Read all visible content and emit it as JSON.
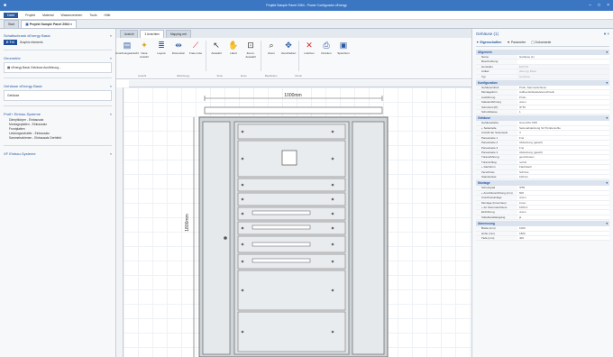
{
  "window": {
    "title": "Projekt Sample Panel 2064 - Power Configurator xEnergy",
    "minimize": "–",
    "maximize": "□",
    "close": "×"
  },
  "menu": {
    "file": "Datei",
    "items": [
      "Projekt",
      "Material",
      "Wasserzeichen",
      "Tools",
      "Hilfe"
    ]
  },
  "doc_tabs": [
    {
      "label": "Start"
    },
    {
      "label": "Projekt Sample Panel 2064",
      "close": "×"
    }
  ],
  "left": {
    "section1": {
      "title": "Schaltschrank xEnergy Basic",
      "collapse": "«"
    },
    "eaton_logo": "E·T·N",
    "eaton_link": "Graphic elements",
    "section2": {
      "title": "Geometrie",
      "collapse": "«"
    },
    "selection": "xEnergy Basic Gehäuse Ausführung...",
    "section3": {
      "title": "Gehäuse xEnergy Basic",
      "collapse": "«"
    },
    "housing_value": "Gehäuse",
    "section4": {
      "title": "Profi+ Einbau-Systeme",
      "collapse": "«"
    },
    "sub_items": [
      "Dämpfkörper - Einbausatz",
      "Montageplatten - Einbausatz",
      "Frontplatten",
      "Leistungsschalter - Einbausatz",
      "Sammelschienen - Einbausatz Drehfeld"
    ],
    "section5": {
      "title": "XF Einbau-Systeme",
      "collapse": "«"
    }
  },
  "canvas_tabs": [
    {
      "label": "Ansicht"
    },
    {
      "label": "3 Ansichten"
    },
    {
      "label": "Mapping.xml"
    }
  ],
  "ribbon": {
    "buttons": [
      {
        "label": "Anordnungsansicht"
      },
      {
        "label": "Neue Ansicht"
      },
      {
        "label": "Layout"
      },
      {
        "label": "Dimension"
      },
      {
        "label": "Freie Linie"
      },
      {
        "label": "Auswahl"
      },
      {
        "label": "Hand"
      },
      {
        "label": "Zoom-Auswahl"
      },
      {
        "label": "Zoom"
      },
      {
        "label": "Verschieben"
      },
      {
        "label": "Löschen"
      },
      {
        "label": "Drucken"
      },
      {
        "label": "Speichern"
      }
    ],
    "groups": [
      "Ansicht",
      "Werkzeuge",
      "Tools",
      "Zoom",
      "Bearbeiten",
      "Druck"
    ]
  },
  "ruler": {
    "top_mark": "1000mm",
    "side_mark": "1800mm"
  },
  "right": {
    "title": "Gehäuse (1)",
    "pin": "▾",
    "close": "×",
    "tabs": [
      {
        "label": "Eigenschaften"
      },
      {
        "label": "Parameter"
      },
      {
        "label": "Dokumente"
      }
    ],
    "sections": [
      {
        "name": "Allgemein",
        "collapse": "▾",
        "rows": [
          {
            "k": "Name",
            "v": "Gehäuse (1)"
          },
          {
            "k": "Beschreibung",
            "v": ""
          },
          {
            "k": "Hersteller",
            "v": "EATON"
          },
          {
            "k": "Artikel",
            "v": "xEnergy Basic"
          },
          {
            "k": "Typ",
            "v": "Gehäuse"
          }
        ]
      },
      {
        "name": "Konfiguration",
        "collapse": "▾",
        "rows": [
          {
            "k": "Gehäuseinheit",
            "v": "Profi+ Sammelschiene"
          },
          {
            "k": "Montageform",
            "v": "Aufbau Einbauleistenschrank"
          },
          {
            "k": "Ausführung",
            "v": "Profi+"
          },
          {
            "k": "Kabeleinführung",
            "v": "unten"
          },
          {
            "k": "Schutzart (IP)",
            "v": "IP 55"
          },
          {
            "k": "Schutzklasse",
            "v": "1"
          }
        ]
      },
      {
        "name": "Gehäuse",
        "collapse": "▾",
        "rows": [
          {
            "k": "Gehäusefarbe",
            "v": "Grau RAL7035"
          },
          {
            "k": "+ Seitenteile",
            "v": "Seitenabdeckung für Pünktersohle"
          },
          {
            "k": "Anzahl der Seitenteile",
            "v": "4"
          },
          {
            "k": "Paneelseite 1",
            "v": "Frei"
          },
          {
            "k": "Paneelseite 2",
            "v": "Abdeckung (geteilt)"
          },
          {
            "k": "Paneelseite 3",
            "v": "Frei"
          },
          {
            "k": "Paneelseite 4",
            "v": "Abdeckung (geteilt)"
          },
          {
            "k": "Türausführung",
            "v": "geschlossen"
          },
          {
            "k": "Türanschlag",
            "v": "rechts"
          },
          {
            "k": "+ Dachform",
            "v": "Flachdach"
          },
          {
            "k": "Verschluss",
            "v": "Schloss"
          },
          {
            "k": "Standsockel",
            "v": "100mm"
          }
        ]
      },
      {
        "name": "Montage",
        "collapse": "▾",
        "rows": [
          {
            "k": "Schutzgrad",
            "v": "IP55"
          },
          {
            "k": "+ Anschlussrichtung (mm)",
            "v": "600"
          },
          {
            "k": "Anschlussanlage",
            "v": "unten"
          },
          {
            "k": "Montage (Innen/aus)",
            "v": "innen"
          },
          {
            "k": "+ Art Sammelschiene",
            "v": "1000 A"
          },
          {
            "k": "Einführung",
            "v": "unten"
          },
          {
            "k": "Kabelkanalausgang",
            "v": "ja"
          }
        ]
      },
      {
        "name": "Abmessung",
        "collapse": "▾",
        "rows": [
          {
            "k": "Breite (mm)",
            "v": "1000"
          },
          {
            "k": "Höhe (mm)",
            "v": "1800"
          },
          {
            "k": "Tiefe (mm)",
            "v": "400"
          }
        ]
      }
    ]
  }
}
